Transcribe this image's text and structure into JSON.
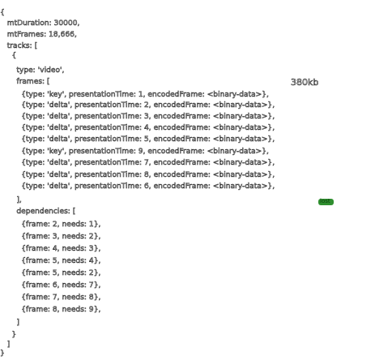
{
  "lines": [
    "{",
    "   mtDuration: 30000,",
    "   mtFrames: 18,666,",
    "   tracks: [",
    "     {",
    "       type: 'video',",
    "       frames: [",
    "         {type: 'key', presentationTime: 1, encodedFrame: <binary-data>},",
    "         {type: 'delta', presentationTime: 2, encodedFrame: <binary-data>},",
    "         {type: 'delta', presentationTime: 3, encodedFrame: <binary-data>},",
    "         {type: 'delta', presentationTime: 4, encodedFrame: <binary-data>},",
    "         {type: 'delta', presentationTime: 5, encodedFrame: <binary-data>},",
    "         {type: 'key', presentationTime: 9, encodedFrame: <binary-data>},",
    "         {type: 'delta', presentationTime: 7, encodedFrame: <binary-data>},",
    "         {type: 'delta', presentationTime: 8, encodedFrame: <binary-data>},",
    "         {type: 'delta', presentationTime: 6, encodedFrame: <binary-data>},",
    "       ],",
    "       dependencies: [",
    "         {frame: 2, needs: 1},",
    "         {frame: 3, needs: 2},",
    "         {frame: 4, needs: 3},",
    "         {frame: 5, needs: 4},",
    "         {frame: 5, needs: 2},",
    "         {frame: 6, needs: 7},",
    "         {frame: 7, needs: 8},",
    "         {frame: 8, needs: 9},",
    "       ]",
    "     }",
    "   ]",
    "}"
  ],
  "annotation": {
    "size": "380kb",
    "mark": "lost"
  }
}
